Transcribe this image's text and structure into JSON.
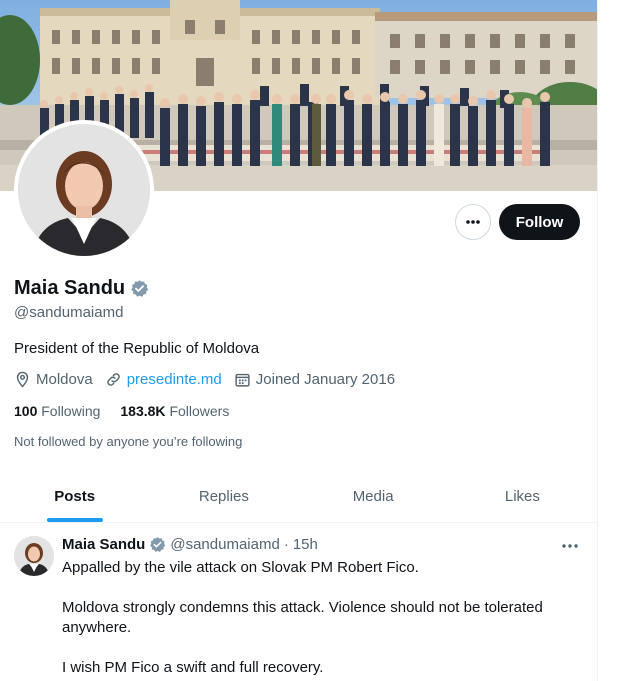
{
  "profile": {
    "name": "Maia Sandu",
    "handle": "@sandumaiamd",
    "bio": "President of the Republic of Moldova",
    "location": "Moldova",
    "website": "presedinte.md",
    "joined": "Joined January 2016",
    "following_count": "100",
    "following_label": "Following",
    "followers_count": "183.8K",
    "followers_label": "Followers",
    "not_followed": "Not followed by anyone you’re following",
    "verified_icon": "verified-badge-icon"
  },
  "actions": {
    "more_icon": "more-horizontal-icon",
    "follow_label": "Follow"
  },
  "tabs": [
    {
      "label": "Posts",
      "active": true
    },
    {
      "label": "Replies",
      "active": false
    },
    {
      "label": "Media",
      "active": false
    },
    {
      "label": "Likes",
      "active": false
    }
  ],
  "tweet": {
    "author": "Maia Sandu",
    "handle": "@sandumaiamd",
    "separator": "·",
    "time": "15h",
    "lines": [
      "Appalled by the vile attack on Slovak PM Robert Fico.",
      "Moldova strongly condemns this attack. Violence should not be tolerated anywhere.",
      "I wish PM Fico a swift and full recovery."
    ]
  },
  "colors": {
    "accent": "#1d9bf0",
    "text": "#0f1419",
    "secondary": "#536471",
    "follow_bg": "#0f1419"
  }
}
